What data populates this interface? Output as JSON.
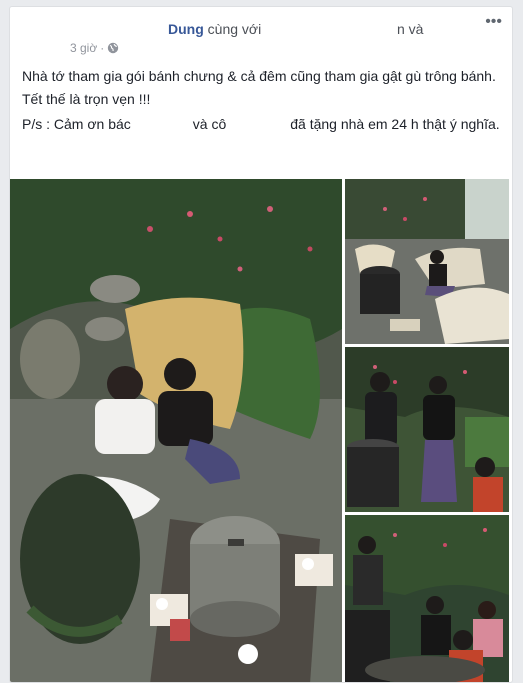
{
  "post": {
    "author_name": "Dung",
    "with_text": "cùng với",
    "and_text": "n và",
    "timestamp": "3 giờ",
    "privacy_icon": "globe-icon",
    "options_icon": "more-options-icon",
    "options_glyph": "•••",
    "text_line1": "Nhà tớ tham gia gói bánh chưng & cả đêm cũng tham gia gật gù trông bánh.",
    "text_line2": "Tết thế là trọn vẹn !!!",
    "ps_prefix": "P/s : Cảm ơn bác",
    "ps_mid": "và cô",
    "ps_suffix": "đã tặng nhà em 24 h thật ý nghĩa."
  },
  "photos": {
    "count": 4,
    "main_alt": "couple-beside-pot-in-garden-photo",
    "p1_alt": "woman-in-sling-chair-photo",
    "p2_alt": "two-women-by-pot-photo",
    "p3_alt": "group-at-night-photo"
  }
}
